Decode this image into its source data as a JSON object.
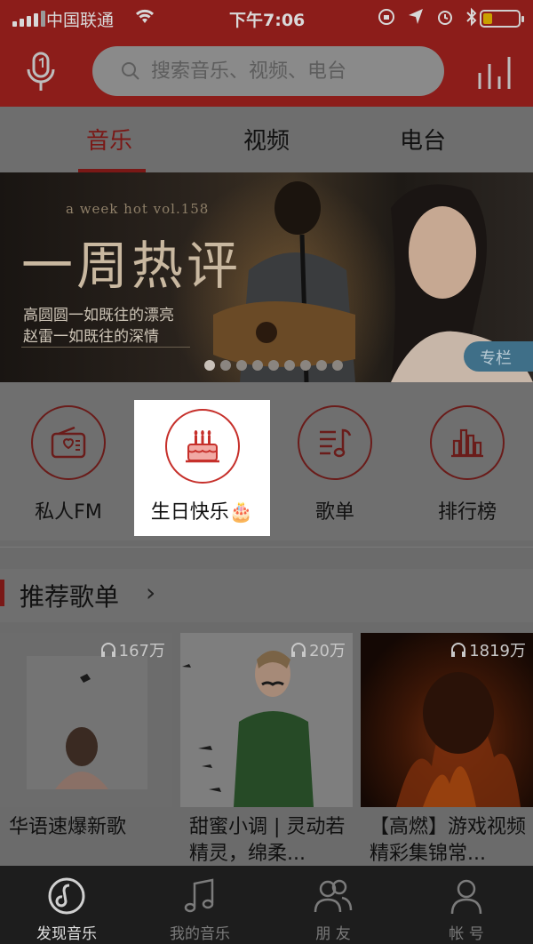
{
  "status_bar": {
    "carrier": "中国联通",
    "time": "下午7:06"
  },
  "header": {
    "search_placeholder": "搜索音乐、视频、电台"
  },
  "tabs": [
    {
      "label": "音乐",
      "active": true
    },
    {
      "label": "视频",
      "active": false
    },
    {
      "label": "电台",
      "active": false
    }
  ],
  "banner": {
    "subtitle_en": "a week hot vol.158",
    "headline": "一周热评",
    "line1": "高圆圆一如既往的漂亮",
    "line2": "赵雷一如既往的深情",
    "tag": "专栏",
    "page_count": 9,
    "current_page": 1
  },
  "entries": [
    {
      "label": "私人FM",
      "icon": "radio-icon"
    },
    {
      "label": "生日快乐🎂",
      "icon": "birthday-cake-icon",
      "highlighted": true
    },
    {
      "label": "歌单",
      "icon": "playlist-icon"
    },
    {
      "label": "排行榜",
      "icon": "chart-bars-icon"
    }
  ],
  "section": {
    "title": "推荐歌单",
    "chevron": "›"
  },
  "playlists": [
    {
      "count": "167万",
      "title": "华语速爆新歌"
    },
    {
      "count": "20万",
      "title": "甜蜜小调 | 灵动若精灵，绵柔..."
    },
    {
      "count": "1819万",
      "title": "【高燃】游戏视频精彩集锦常..."
    }
  ],
  "tabbar": [
    {
      "label": "发现音乐",
      "active": true
    },
    {
      "label": "我的音乐",
      "active": false
    },
    {
      "label": "朋 友",
      "active": false
    },
    {
      "label": "帐 号",
      "active": false
    }
  ],
  "colors": {
    "brand_red": "#c6302b",
    "header_dimmed": "#8c1d1a"
  }
}
